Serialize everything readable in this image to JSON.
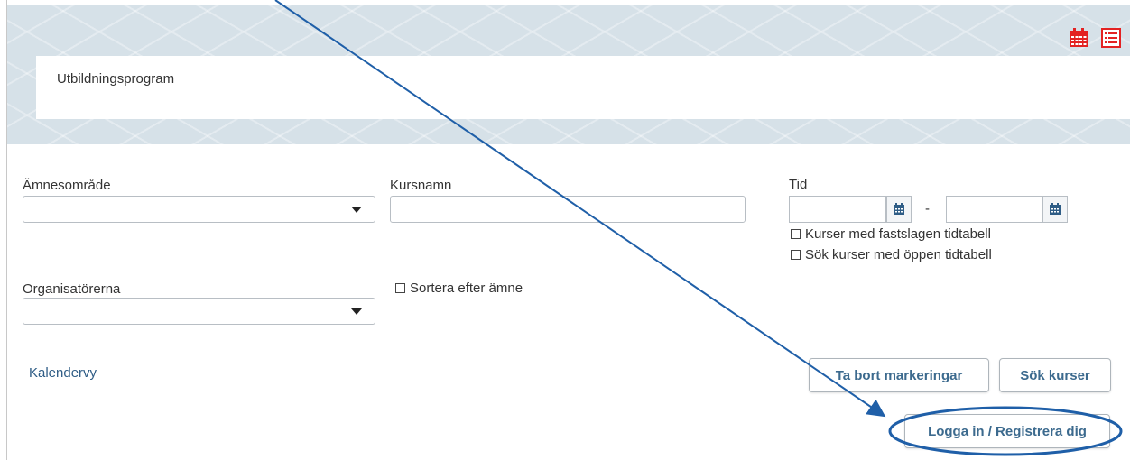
{
  "header": {
    "program_title": "Utbildningsprogram",
    "icons": [
      "calendar-icon",
      "list-view-icon"
    ],
    "icon_color": "#e32222"
  },
  "filters": {
    "subject_area": {
      "label": "Ämnesområde",
      "value": ""
    },
    "course_name": {
      "label": "Kursnamn",
      "value": ""
    },
    "time": {
      "label": "Tid",
      "separator": "-",
      "from_value": "",
      "to_value": "",
      "fixed_schedule_label": "Kurser med fastslagen tidtabell",
      "open_schedule_label": "Sök kurser med öppen tidtabell"
    },
    "organizers": {
      "label": "Organisatörerna",
      "value": ""
    },
    "sort_by_subject_label": "Sortera efter ämne"
  },
  "actions": {
    "calendar_view_link": "Kalendervy",
    "clear_marks_button": "Ta bort markeringar",
    "search_button": "Sök kurser",
    "login_button": "Logga in / Registrera dig"
  },
  "colors": {
    "banner": "#d6e1e8",
    "accent_blue": "#2f5d86",
    "annotation_blue": "#1f5fa8",
    "calendar_button_icon": "#2f5d86"
  }
}
